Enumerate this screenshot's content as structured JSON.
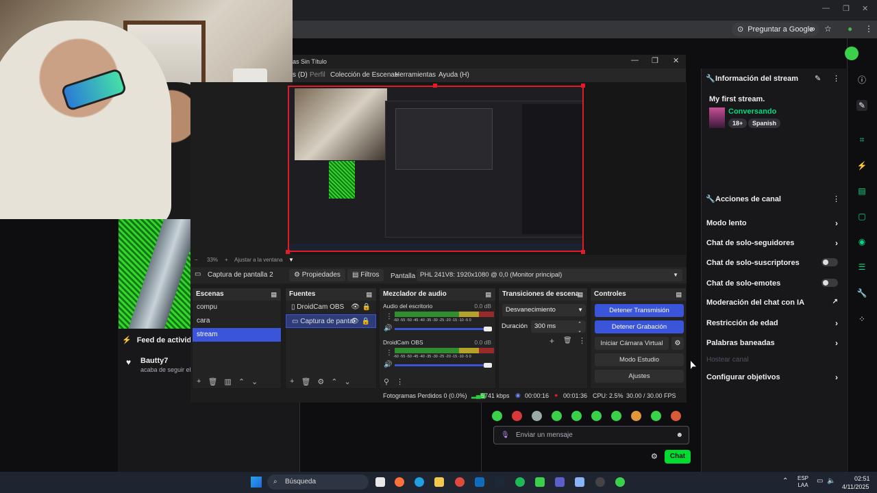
{
  "browser": {
    "ask_google": "Preguntar a Google"
  },
  "obs": {
    "window_title": "as Sin Título",
    "menu": [
      "s (D)",
      "Perfil",
      "Colección de Escenas",
      "Herramientas",
      "Ayuda (H)"
    ],
    "zoom_label": "33%",
    "fit_label": "Ajustar a la ventana",
    "source_name": "Captura de pantalla 2",
    "properties": "Propiedades",
    "filters": "Filtros",
    "screen_label": "Pantalla",
    "screen_value": "PHL 241V8: 1920x1080 @ 0,0 (Monitor principal)",
    "scenes": {
      "title": "Escenas",
      "items": [
        "compu",
        "cara",
        "stream"
      ],
      "selected": "stream"
    },
    "sources": {
      "title": "Fuentes",
      "items": [
        "DroidCam OBS",
        "Captura de pantal"
      ]
    },
    "mixer": {
      "title": "Mezclador de audio",
      "channels": [
        {
          "name": "Audio del escritorio",
          "db": "0.0 dB"
        },
        {
          "name": "DroidCam OBS",
          "db": "0.0 dB"
        }
      ],
      "scale": "-60 -55 -50 -45 -40 -35 -30 -25 -20 -15 -10 -5 0"
    },
    "transitions": {
      "title": "Transiciones de escena",
      "selected": "Desvanecimiento",
      "duration_label": "Duración",
      "duration_value": "300 ms"
    },
    "controls": {
      "title": "Controles",
      "stop_stream": "Detener Transmisión",
      "stop_recording": "Detener Grabación",
      "virtual_cam": "Iniciar Cámara Virtual",
      "studio_mode": "Modo Estudio",
      "settings": "Ajustes"
    },
    "status": {
      "dropped": "Fotogramas Perdidos 0 (0.0%)",
      "bitrate": "5741 kbps",
      "stream_time": "00:00:16",
      "rec_time": "00:01:36",
      "cpu": "CPU: 2.5%",
      "fps": "30.00 / 30.00 FPS"
    }
  },
  "twitch": {
    "feed_title": "Feed de actividades",
    "feed_user": "Bautty7",
    "feed_text": "acaba de seguir el",
    "stream_info_title": "Información del stream",
    "stream_name": "My first stream.",
    "category": "Conversando",
    "tags": [
      "18+",
      "Spanish"
    ],
    "actions_title": "Acciones de canal",
    "actions": [
      {
        "label": "Modo lento",
        "type": "arrow"
      },
      {
        "label": "Chat de solo-seguidores",
        "type": "arrow"
      },
      {
        "label": "Chat de solo-suscriptores",
        "type": "toggle"
      },
      {
        "label": "Chat de solo-emotes",
        "type": "toggle"
      },
      {
        "label": "Moderación del chat con IA",
        "type": "external"
      },
      {
        "label": "Restricción de edad",
        "type": "arrow"
      },
      {
        "label": "Palabras baneadas",
        "type": "arrow"
      },
      {
        "label": "Hostear canal",
        "type": "disabled"
      },
      {
        "label": "Configurar objetivos",
        "type": "arrow"
      }
    ],
    "chat_placeholder": "Enviar un mensaje",
    "chat_button": "Chat"
  },
  "taskbar": {
    "search": "Búsqueda",
    "lang_1": "ESP",
    "lang_2": "LAA",
    "time": "02:51",
    "date": "4/11/2025"
  }
}
